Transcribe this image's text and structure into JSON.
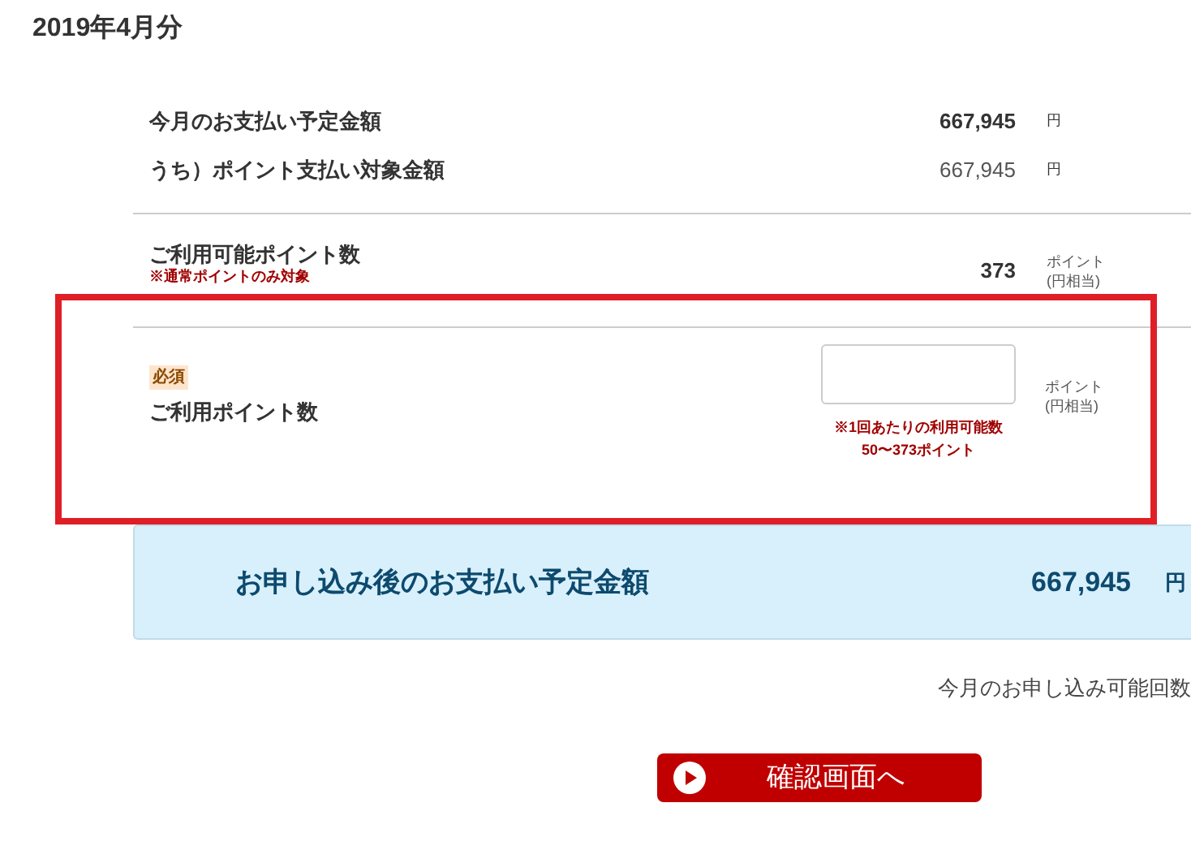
{
  "title": "2019年4月分",
  "summary_rows": [
    {
      "label": "今月のお支払い予定金額",
      "value": "667,945",
      "unit": "円",
      "emphasis": true
    },
    {
      "label": "うち）ポイント支払い対象金額",
      "value": "667,945",
      "unit": "円",
      "emphasis": false
    }
  ],
  "available_points": {
    "label": "ご利用可能ポイント数",
    "note": "※通常ポイントのみ対象",
    "value": "373",
    "unit": "ポイント",
    "unit_note": "(円相当)"
  },
  "use_points": {
    "badge": "必須",
    "label": "ご利用ポイント数",
    "note_lines": [
      "※1回あたりの利用可能数",
      "50〜373ポイント"
    ],
    "unit": "ポイント",
    "unit_note": "(円相当)",
    "highlighted": true
  },
  "total": {
    "label": "お申し込み後のお支払い予定金額",
    "value": "667,945",
    "unit": "円"
  },
  "remaining_label": "今月のお申し込み可能回数",
  "confirm_button": {
    "label": "確認画面へ"
  }
}
